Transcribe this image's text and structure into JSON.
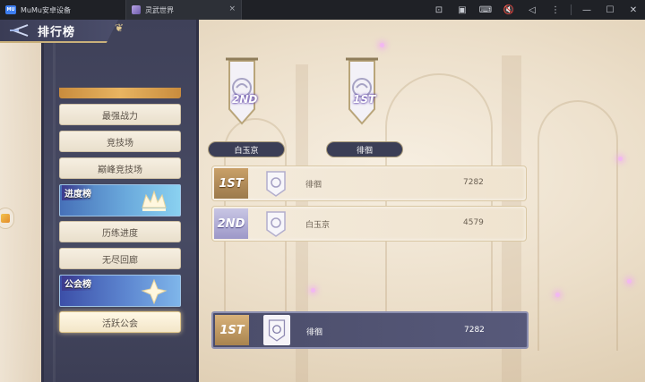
{
  "window": {
    "home_tab_label": "MuMu安卓设备",
    "game_tab_label": "灵武世界",
    "home_logo_text": "MU",
    "close_glyph": "×",
    "tools": [
      {
        "icon": "screenshot-icon",
        "glyph": "⊡"
      },
      {
        "icon": "record-icon",
        "glyph": "▣"
      },
      {
        "icon": "keyboard-icon",
        "glyph": "⌨"
      },
      {
        "icon": "mute-icon",
        "glyph": "🔇"
      },
      {
        "icon": "back-icon",
        "glyph": "◁"
      },
      {
        "icon": "more-icon",
        "glyph": "⋮"
      },
      {
        "icon": "minimize-icon",
        "glyph": "—"
      },
      {
        "icon": "maximize-icon",
        "glyph": "☐"
      },
      {
        "icon": "close-icon",
        "glyph": "✕"
      }
    ]
  },
  "header": {
    "title": "排行榜"
  },
  "menu": {
    "items": [
      {
        "label": "最强战力"
      },
      {
        "label": "竞技场"
      },
      {
        "label": "巅峰竞技场"
      },
      {
        "label": "历练进度"
      },
      {
        "label": "无尽回廊"
      },
      {
        "label": "活跃公会",
        "active": true
      }
    ],
    "categories": [
      {
        "label": "进度榜"
      },
      {
        "label": "公会榜"
      }
    ]
  },
  "podium": [
    {
      "rank_text": "2ND",
      "name": "白玉京"
    },
    {
      "rank_text": "1ST",
      "name": "徘徊"
    }
  ],
  "rankings": [
    {
      "rank_text": "1ST",
      "name": "徘徊",
      "score": "7282"
    },
    {
      "rank_text": "2ND",
      "name": "白玉京",
      "score": "4579"
    }
  ],
  "my_rank": {
    "rank_text": "1ST",
    "name": "徘徊",
    "score": "7282"
  },
  "colors": {
    "sidebar": "#474a63",
    "gold_accent": "#c9b07a",
    "first_rank": "#b08d5a",
    "second_rank": "#a6a2d0"
  }
}
